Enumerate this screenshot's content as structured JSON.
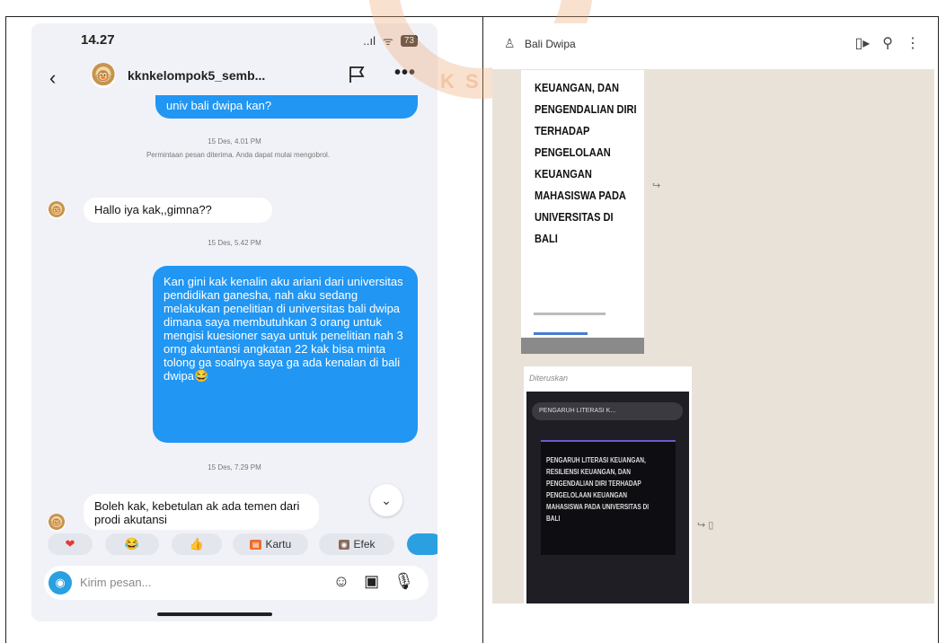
{
  "watermark": {
    "text": "K S"
  },
  "left": {
    "status": {
      "time": "14.27",
      "signal": "..ıl",
      "wifi": "ᯤ",
      "battery": "73"
    },
    "header": {
      "back": "‹",
      "username": "kknkelompok5_semb...",
      "more": "•••"
    },
    "messages": {
      "prev_bubble": "univ bali dwipa kan?",
      "meta1": "15 Des, 4.01 PM",
      "system": "Permintaan pesan diterima. Anda dapat mulai mengobrol.",
      "reply1": "Hallo iya  kak,,gimna??",
      "meta2": "15 Des, 5.42 PM",
      "long": "Kan gini kak kenalin aku ariani dari universitas pendidikan ganesha, nah aku sedang melakukan penelitian di universitas bali dwipa dimana saya membutuhkan 3 orang untuk mengisi kuesioner saya untuk penelitian nah 3 orng akuntansi angkatan 22 kak bisa minta tolong ga soalnya saya ga ada kenalan di bali dwipa😂",
      "meta3": "15 Des, 7.29 PM",
      "reply2": "Boleh kak, kebetulan ak ada temen dari prodi akutansi"
    },
    "reactions": [
      {
        "icon": "❤",
        "color": "#e53935"
      },
      {
        "icon": "😂",
        "color": "#f4b400"
      },
      {
        "icon": "👍",
        "color": "#f4b400"
      },
      {
        "tag": "Kartu",
        "label": "Kartu"
      },
      {
        "tag": "Efek",
        "label": "Efek"
      }
    ],
    "input": {
      "placeholder": "Kirim pesan..."
    },
    "icons": {
      "sticker": "☺",
      "gallery": "▣",
      "mic": "🎙"
    }
  },
  "right": {
    "header": {
      "name": "Bali Dwipa",
      "icons": [
        "video-icon",
        "search-icon",
        "menu-icon"
      ]
    },
    "doc1_lines": [
      "KEUANGAN, DAN",
      "PENGENDALIAN DIRI",
      "TERHADAP",
      "PENGELOLAAN",
      "KEUANGAN",
      "MAHASISWA PADA",
      "UNIVERSITAS DI",
      "BALI"
    ],
    "forwarded_label": "Diteruskan",
    "doc2_bar": "PENGARUH LITERASI K...",
    "doc2_lines": [
      "PENGARUH LITERASI KEUANGAN,",
      "RESILIENSI KEUANGAN, DAN",
      "PENGENDALIAN DIRI TERHADAP",
      "PENGELOLAAN KEUANGAN",
      "MAHASISWA PADA UNIVERSITAS DI",
      "BALI"
    ]
  }
}
